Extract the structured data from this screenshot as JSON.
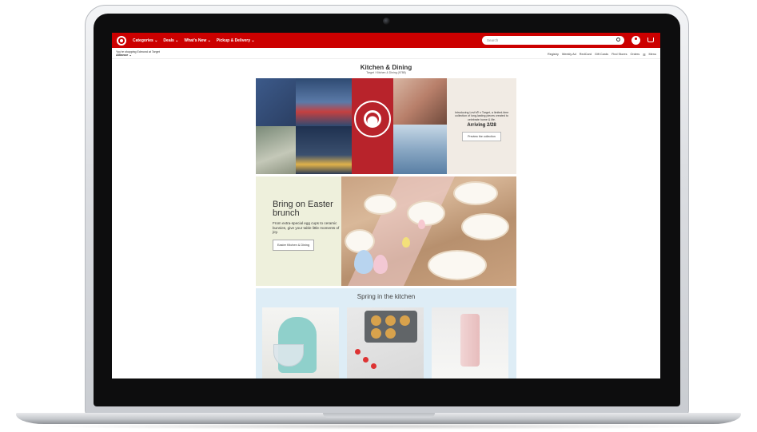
{
  "header": {
    "nav": [
      "Categories ⌄",
      "Deals ⌄",
      "What's New ⌄",
      "Pickup & Delivery ⌄"
    ],
    "search_placeholder": "Search"
  },
  "subbar": {
    "store_line": "You're shopping Edmond at Target",
    "store_name": "Alliance ⌄",
    "utility": [
      "Registry",
      "Weekly Ad",
      "RedCard",
      "Gift Cards",
      "Find Stores",
      "Orders",
      "☰",
      "Menu"
    ]
  },
  "page": {
    "title": "Kitchen & Dining",
    "breadcrumb": "Target / Kitchen & Dining (9788)"
  },
  "hero1": {
    "promo_text": "Introducing Levi's® x Target, a limited-time collection of long-lasting pieces created to celebrate home & life.",
    "date": "Arriving 2/28",
    "button": "Preview the collection"
  },
  "hero2": {
    "heading": "Bring on Easter brunch",
    "body": "From extra-special egg cups to ceramic bunnies, give your table little moments of joy.",
    "button": "Easter Kitchen & Dining"
  },
  "spring": {
    "title": "Spring in the kitchen"
  },
  "colors": {
    "target_red": "#cc0000",
    "easter_bg": "#eef0dc",
    "spring_bg": "#deedf6",
    "promo_bg": "#f1ebe4"
  }
}
